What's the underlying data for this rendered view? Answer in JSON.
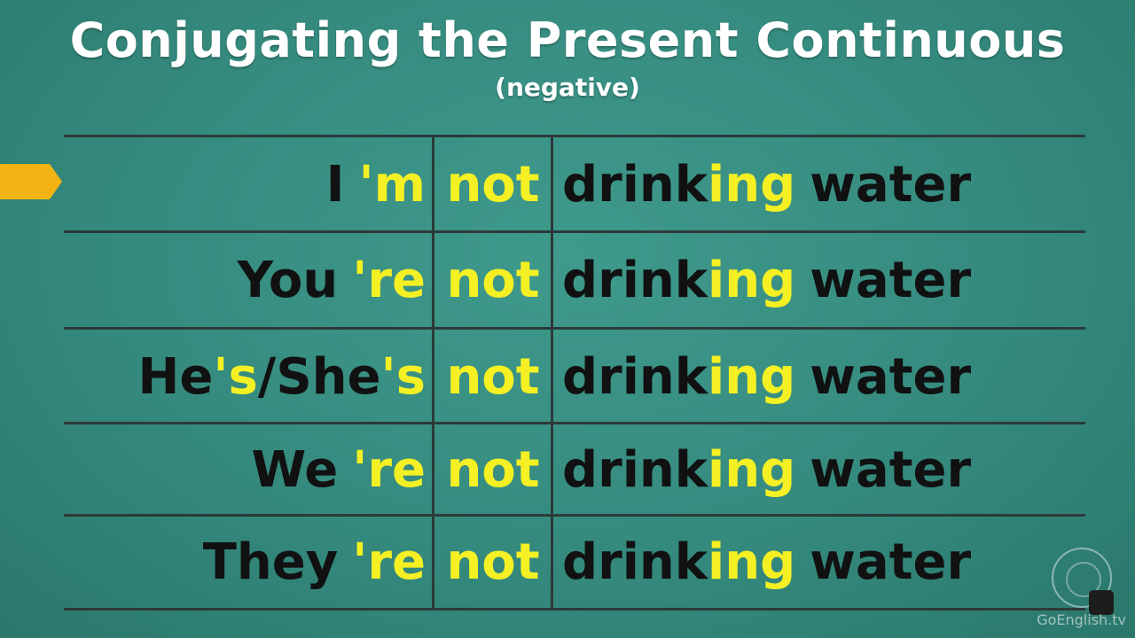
{
  "header": {
    "title": "Conjugating the Present Continuous",
    "subtitle": "(negative)"
  },
  "rows": [
    {
      "subject": "I",
      "contraction": "'m",
      "negation": "not",
      "verb_stem": "drink",
      "verb_suffix": "ing",
      "object": "water"
    },
    {
      "subject": "You",
      "contraction": "'re",
      "negation": "not",
      "verb_stem": "drink",
      "verb_suffix": "ing",
      "object": "water"
    },
    {
      "subject_a": "He",
      "contraction_a": "'s",
      "slash": "/",
      "subject_b": "She",
      "contraction_b": "'s",
      "negation": "not",
      "verb_stem": "drink",
      "verb_suffix": "ing",
      "object": "water"
    },
    {
      "subject": "We",
      "contraction": "'re",
      "negation": "not",
      "verb_stem": "drink",
      "verb_suffix": "ing",
      "object": "water"
    },
    {
      "subject": "They",
      "contraction": "'re",
      "negation": "not",
      "verb_stem": "drink",
      "verb_suffix": "ing",
      "object": "water"
    }
  ],
  "pointer": {
    "current_row": 1
  },
  "watermark": {
    "text": "GoEnglish.tv"
  },
  "colors": {
    "background": "#358a7e",
    "highlight": "#f5f023",
    "text": "#111111",
    "pointer": "#f3b312",
    "grid": "#2c3a39"
  }
}
